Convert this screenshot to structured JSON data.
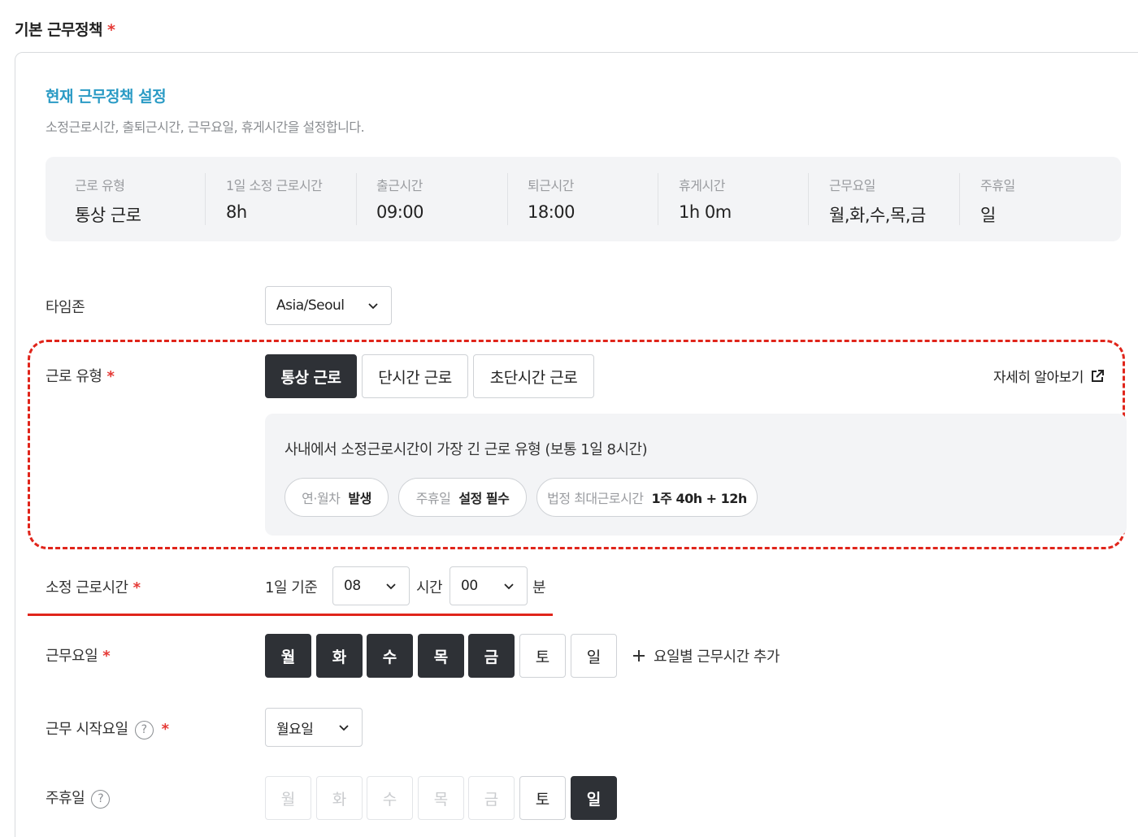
{
  "section_title": "기본 근무정책",
  "required_mark": "*",
  "current": {
    "title": "현재 근무정책 설정",
    "description": "소정근로시간, 출퇴근시간, 근무요일, 휴게시간을 설정합니다."
  },
  "summary": [
    {
      "label": "근로 유형",
      "value": "통상 근로"
    },
    {
      "label": "1일 소정 근로시간",
      "value": "8h"
    },
    {
      "label": "출근시간",
      "value": "09:00"
    },
    {
      "label": "퇴근시간",
      "value": "18:00"
    },
    {
      "label": "휴게시간",
      "value": "1h 0m"
    },
    {
      "label": "근무요일",
      "value": "월,화,수,목,금"
    },
    {
      "label": "주휴일",
      "value": "일"
    }
  ],
  "timezone": {
    "label": "타임존",
    "value": "Asia/Seoul"
  },
  "work_type": {
    "label": "근로 유형",
    "options": [
      "통상 근로",
      "단시간 근로",
      "초단시간 근로"
    ],
    "selected": "통상 근로",
    "more_link": "자세히 알아보기",
    "info_text": "사내에서 소정근로시간이 가장 긴 근로 유형 (보통 1일 8시간)",
    "chips": [
      {
        "key": "연·월차",
        "value": "발생"
      },
      {
        "key": "주휴일",
        "value": "설정 필수"
      },
      {
        "key": "법정 최대근로시간",
        "value": "1주 40h + 12h"
      }
    ]
  },
  "work_hours": {
    "label": "소정 근로시간",
    "basis": "1일 기준",
    "hours": "08",
    "hours_unit": "시간",
    "minutes": "00",
    "minutes_unit": "분"
  },
  "work_days": {
    "label": "근무요일",
    "days": [
      {
        "name": "월",
        "on": true
      },
      {
        "name": "화",
        "on": true
      },
      {
        "name": "수",
        "on": true
      },
      {
        "name": "목",
        "on": true
      },
      {
        "name": "금",
        "on": true
      },
      {
        "name": "토",
        "on": false
      },
      {
        "name": "일",
        "on": false
      }
    ],
    "add_label": "요일별 근무시간 추가"
  },
  "start_day": {
    "label": "근무 시작요일",
    "value": "월요일"
  },
  "weekly_holiday": {
    "label": "주휴일",
    "days": [
      {
        "name": "월",
        "state": "disabled"
      },
      {
        "name": "화",
        "state": "disabled"
      },
      {
        "name": "수",
        "state": "disabled"
      },
      {
        "name": "목",
        "state": "disabled"
      },
      {
        "name": "금",
        "state": "disabled"
      },
      {
        "name": "토",
        "state": "off"
      },
      {
        "name": "일",
        "state": "on"
      }
    ]
  },
  "colors": {
    "accent": "#2b9bc5",
    "required": "#e53935",
    "highlight": "#e0251b",
    "active": "#2e3136"
  }
}
